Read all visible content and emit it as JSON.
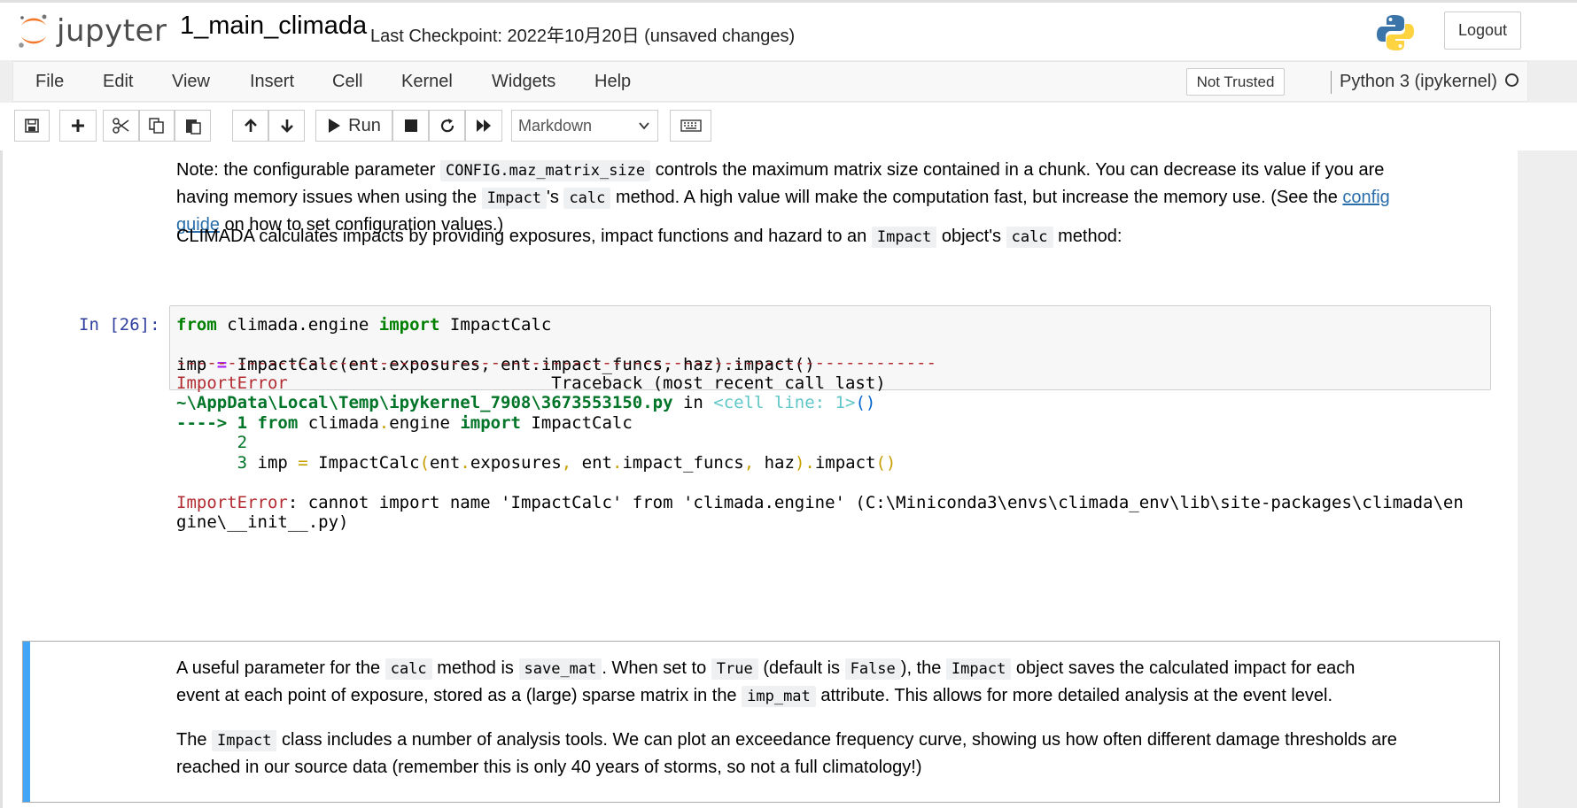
{
  "header": {
    "logo_text": "jupyter",
    "notebook_name": "1_main_climada",
    "checkpoint": "Last Checkpoint: 2022年10月20日   (unsaved changes)",
    "logout_label": "Logout"
  },
  "menu": {
    "items": [
      "File",
      "Edit",
      "View",
      "Insert",
      "Cell",
      "Kernel",
      "Widgets",
      "Help"
    ],
    "trust_label": "Not Trusted",
    "kernel_name": "Python 3 (ipykernel)"
  },
  "toolbar": {
    "run_label": "Run",
    "cell_type": "Markdown"
  },
  "cells": {
    "md1_line1_a": "Note: the configurable parameter",
    "md1_code_a": "CONFIG.maz_matrix_size",
    "md1_line1_b": "controls the maximum matrix size contained in a chunk. You can decrease its value if you are",
    "md1_line2_a": "having memory issues when using the",
    "md1_code_b": "Impact",
    "md1_line2_b": "'s",
    "md1_code_c": "calc",
    "md1_line2_c": "method. A high value will make the computation fast, but increase the memory use. (See the",
    "md1_link_a": "config",
    "md1_link_b": "guide",
    "md1_line3": "on how to set configuration values.)",
    "md2_a": "CLIMADA calculates impacts by providing exposures, impact functions and hazard to an",
    "md2_code_a": "Impact",
    "md2_b": "object's",
    "md2_code_b": "calc",
    "md2_c": "method:",
    "prompt": "In [26]:",
    "code": {
      "l1_kw1": "from",
      "l1_mod": " climada.engine ",
      "l1_kw2": "import",
      "l1_name": " ImpactCalc",
      "l3_a": "imp ",
      "l3_op": "=",
      "l3_b": " ImpactCalc(ent.exposures, ent.impact_funcs, haz).impact()"
    },
    "output": {
      "dashes": "---------------------------------------------------------------------------",
      "err_name": "ImportError",
      "traceback": "                          Traceback (most recent call last)",
      "path": "~\\AppData\\Local\\Temp\\ipykernel_7908\\3673553150.py",
      "in": " in ",
      "cell_line": "<cell line: 1>",
      "parens": "()",
      "arrow": "----> 1 ",
      "t1_kw1": "from",
      "t1_mod": " climada",
      "t1_dot": ".",
      "t1_engine": "engine ",
      "t1_kw2": "import",
      "t1_name": " ImpactCalc",
      "t2_num": "      2",
      "t3_num": "      3",
      "t3_a": " imp ",
      "t3_eq": "=",
      "t3_b": " ImpactCalc",
      "t3_p1": "(",
      "t3_c": "ent",
      "t3_d1": ".",
      "t3_e": "exposures",
      "t3_cm1": ",",
      "t3_f": " ent",
      "t3_d2": ".",
      "t3_g": "impact_funcs",
      "t3_cm2": ",",
      "t3_h": " haz",
      "t3_p2": ")",
      "t3_d3": ".",
      "t3_i": "impact",
      "t3_p3": "()",
      "final_err": "ImportError",
      "final_msg1": ": cannot import name 'ImpactCalc' from 'climada.engine' (C:\\Miniconda3\\envs\\climada_env\\lib\\site-packages\\climada\\en",
      "final_msg2": "gine\\__init__.py)"
    },
    "md3_a": "A useful parameter for the",
    "md3_code_a": "calc",
    "md3_b": "method is",
    "md3_code_b": "save_mat",
    "md3_c": ". When set to",
    "md3_code_c": "True",
    "md3_d": "(default is",
    "md3_code_d": "False",
    "md3_e": "), the",
    "md3_code_e": "Impact",
    "md3_f": "object saves the calculated impact for each",
    "md3_line2_a": "event at each point of exposure, stored as a (large) sparse matrix in the",
    "md3_code_f": "imp_mat",
    "md3_line2_b": "attribute. This allows for more detailed analysis at the event level.",
    "md4_a": "The",
    "md4_code": "Impact",
    "md4_b": "class includes a number of analysis tools. We can plot an exceedance frequency curve, showing us how often different damage thresholds are",
    "md4_line2": "reached in our source data (remember this is only 40 years of storms, so not a full climatology!)"
  }
}
